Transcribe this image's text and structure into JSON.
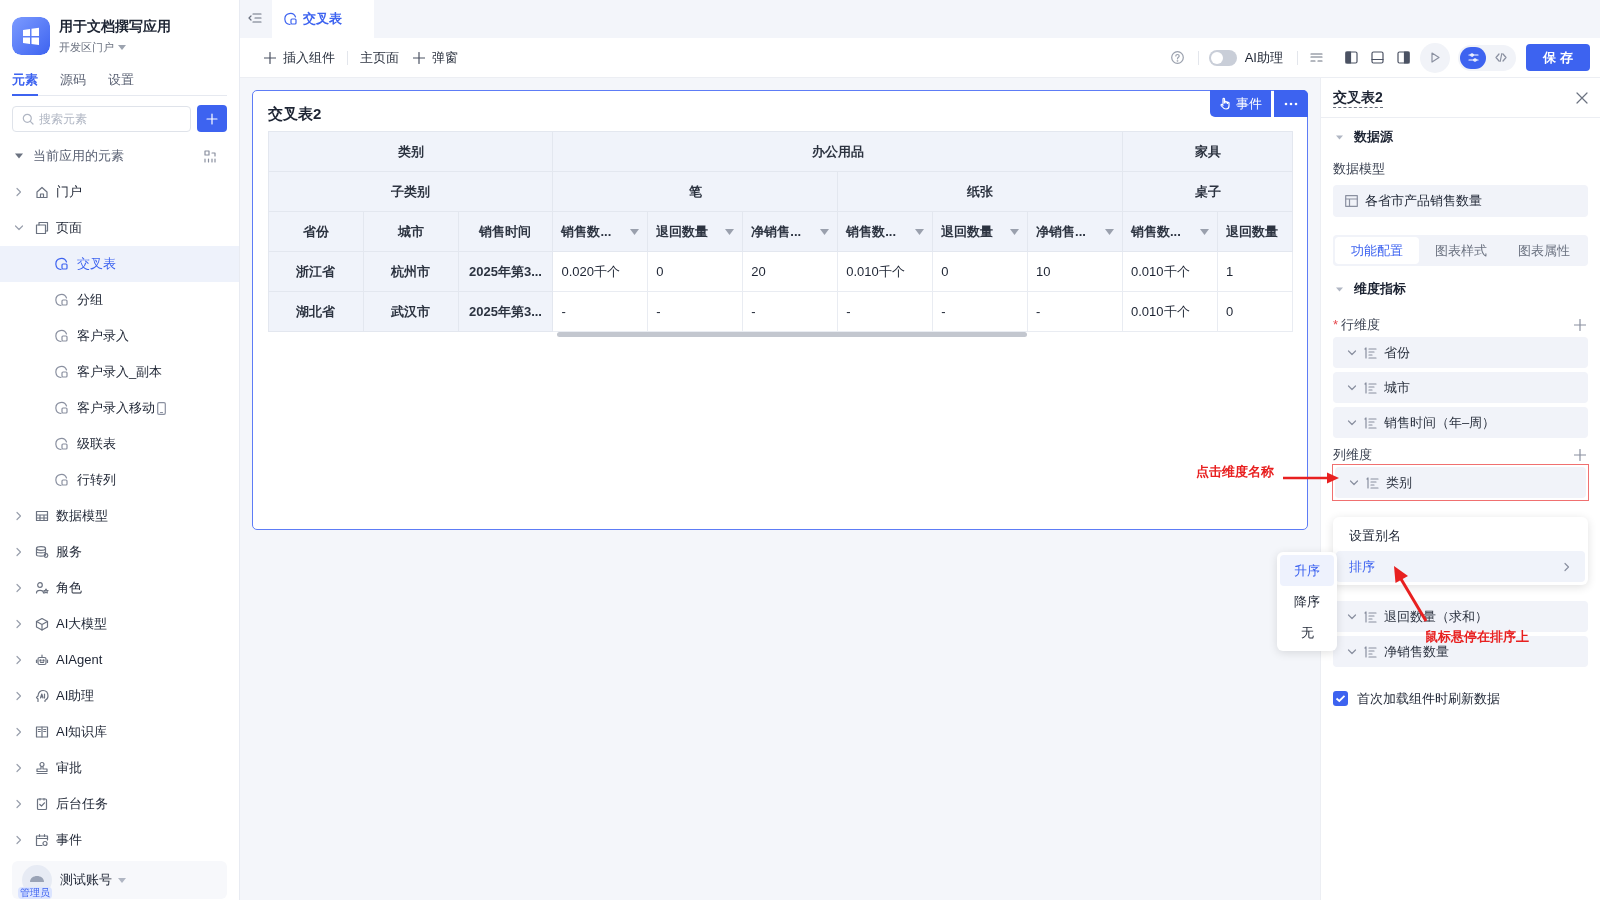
{
  "app": {
    "name": "用于文档撰写应用",
    "portal": "开发区门户"
  },
  "sidebar_tabs": [
    {
      "label": "元素",
      "selected": true
    },
    {
      "label": "源码",
      "selected": false
    },
    {
      "label": "设置",
      "selected": false
    }
  ],
  "search": {
    "placeholder": "搜索元素"
  },
  "tree": {
    "title": "当前应用的元素",
    "expanded": true,
    "items": [
      {
        "label": "门户",
        "kind": "home",
        "expanded": false,
        "selected": false
      },
      {
        "label": "页面",
        "kind": "pages",
        "expanded": true,
        "selected": false,
        "children": [
          {
            "label": "交叉表",
            "kind": "page",
            "selected": true
          },
          {
            "label": "分组",
            "kind": "page",
            "selected": false
          },
          {
            "label": "客户录入",
            "kind": "page",
            "selected": false
          },
          {
            "label": "客户录入_副本",
            "kind": "page",
            "selected": false
          },
          {
            "label": "客户录入移动",
            "kind": "page",
            "selected": false,
            "mobile": true
          },
          {
            "label": "级联表",
            "kind": "page",
            "selected": false
          },
          {
            "label": "行转列",
            "kind": "page",
            "selected": false
          }
        ]
      },
      {
        "label": "数据模型",
        "kind": "table",
        "expanded": false,
        "selected": false
      },
      {
        "label": "服务",
        "kind": "service",
        "expanded": false,
        "selected": false
      },
      {
        "label": "角色",
        "kind": "role",
        "expanded": false,
        "selected": false
      },
      {
        "label": "AI大模型",
        "kind": "cube",
        "expanded": false,
        "selected": false
      },
      {
        "label": "AIAgent",
        "kind": "robot",
        "expanded": false,
        "selected": false
      },
      {
        "label": "AI助理",
        "kind": "ai",
        "expanded": false,
        "selected": false
      },
      {
        "label": "AI知识库",
        "kind": "book",
        "expanded": false,
        "selected": false
      },
      {
        "label": "审批",
        "kind": "stamp",
        "expanded": false,
        "selected": false
      },
      {
        "label": "后台任务",
        "kind": "task",
        "expanded": false,
        "selected": false
      },
      {
        "label": "事件",
        "kind": "event",
        "expanded": false,
        "selected": false
      }
    ]
  },
  "account": {
    "name": "测试账号",
    "role": "管理员"
  },
  "editor_tabs": [
    {
      "label": "交叉表",
      "selected": true
    }
  ],
  "toolbar": {
    "items": [
      {
        "label": "插入组件",
        "kind": "add"
      },
      {
        "label": "主页面",
        "kind": "plain"
      },
      {
        "label": "弹窗",
        "kind": "add"
      }
    ],
    "ai_assistant": {
      "label": "AI助理",
      "on": false
    },
    "view_modes": [
      {
        "kind": "settings",
        "selected": true
      },
      {
        "kind": "code",
        "selected": false
      }
    ],
    "save": "保 存"
  },
  "card": {
    "title": "交叉表2",
    "event_button": "事件",
    "table": {
      "column_dimension_labels": [
        "类别",
        "子类别"
      ],
      "row_headers": [
        "省份",
        "城市",
        "销售时间"
      ],
      "column_groups": [
        {
          "label": "办公用品",
          "children": [
            {
              "label": "笔",
              "measures": [
                {
                  "label": "销售数...",
                  "sort_icon": true
                },
                {
                  "label": "退回数量",
                  "sort_icon": true
                },
                {
                  "label": "净销售...",
                  "sort_icon": true
                }
              ]
            },
            {
              "label": "纸张",
              "measures": [
                {
                  "label": "销售数...",
                  "sort_icon": true
                },
                {
                  "label": "退回数量",
                  "sort_icon": true
                },
                {
                  "label": "净销售...",
                  "sort_icon": true
                }
              ]
            }
          ]
        },
        {
          "label": "家具",
          "children": [
            {
              "label": "桌子",
              "measures": [
                {
                  "label": "销售数...",
                  "sort_icon": true
                },
                {
                  "label": "退回数量",
                  "sort_icon": false
                }
              ]
            }
          ]
        }
      ],
      "rows": [
        {
          "headers": [
            "浙江省",
            "杭州市",
            "2025年第3..."
          ],
          "values": [
            "0.020千个",
            "0",
            "20",
            "0.010千个",
            "0",
            "10",
            "0.010千个",
            "1"
          ]
        },
        {
          "headers": [
            "湖北省",
            "武汉市",
            "2025年第3..."
          ],
          "values": [
            "-",
            "-",
            "-",
            "-",
            "-",
            "-",
            "0.010千个",
            "0"
          ]
        }
      ]
    }
  },
  "panel": {
    "title": "交叉表2",
    "data_source": {
      "heading": "数据源",
      "expanded": true,
      "model_label": "数据模型",
      "model": "各省市产品销售数量"
    },
    "tabs": [
      {
        "label": "功能配置",
        "selected": true
      },
      {
        "label": "图表样式",
        "selected": false
      },
      {
        "label": "图表属性",
        "selected": false
      }
    ],
    "dimensions": {
      "heading": "维度指标",
      "expanded": true,
      "row_label": "行维度",
      "row_required_mark": "*",
      "row_dimensions": [
        {
          "label": "省份"
        },
        {
          "label": "城市"
        },
        {
          "label": "销售时间（年–周）"
        }
      ],
      "column_label": "列维度",
      "column_dimensions": [
        {
          "label": "类别",
          "highlighted": true
        }
      ],
      "measures": [
        {
          "label": "退回数量（求和）"
        },
        {
          "label": "净销售数量"
        }
      ]
    },
    "refresh_on_load": {
      "label": "首次加载组件时刷新数据",
      "checked": true
    }
  },
  "context_menu": {
    "items": [
      {
        "label": "设置别名",
        "selected": false,
        "submenu": false
      },
      {
        "label": "排序",
        "selected": true,
        "submenu": true
      }
    ],
    "submenu": [
      {
        "label": "升序",
        "selected": true
      },
      {
        "label": "降序",
        "selected": false
      },
      {
        "label": "无",
        "selected": false
      }
    ]
  },
  "annotations": [
    {
      "kind": "arrow_label",
      "text": "点击维度名称"
    },
    {
      "kind": "arrow_label",
      "text": "鼠标悬停在排序上"
    }
  ]
}
